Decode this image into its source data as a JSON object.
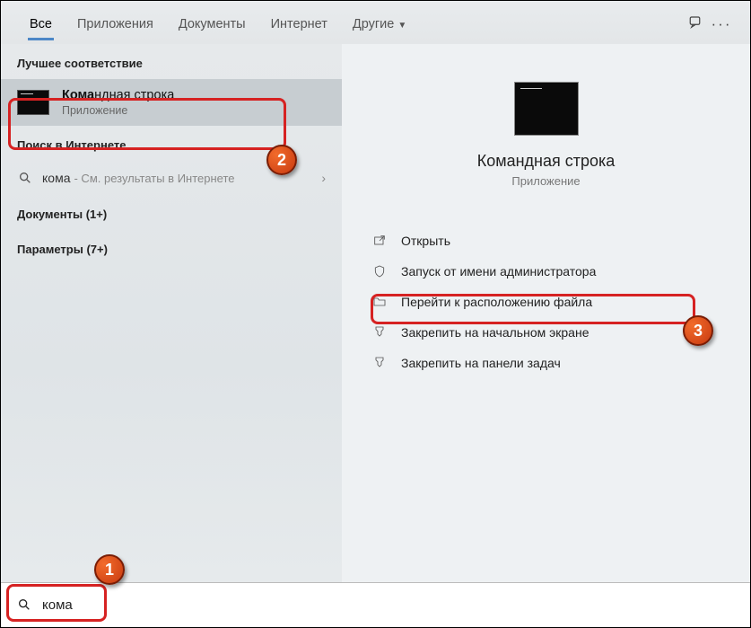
{
  "tabs": {
    "all": "Все",
    "apps": "Приложения",
    "docs": "Документы",
    "web": "Интернет",
    "more": "Другие"
  },
  "left": {
    "best_header": "Лучшее соответствие",
    "best_title_pre": "Кома",
    "best_title_post": "ндная строка",
    "best_sub": "Приложение",
    "web_header": "Поиск в Интернете",
    "web_query": "кома",
    "web_hint": " - См. результаты в Интернете",
    "docs_header": "Документы (1+)",
    "params_header": "Параметры (7+)"
  },
  "preview": {
    "title": "Командная строка",
    "sub": "Приложение"
  },
  "actions": {
    "open": "Открыть",
    "admin": "Запуск от имени администратора",
    "location": "Перейти к расположению файла",
    "pin_start": "Закрепить на начальном экране",
    "pin_task": "Закрепить на панели задач"
  },
  "search": {
    "value": "кома"
  },
  "badges": {
    "b1": "1",
    "b2": "2",
    "b3": "3"
  }
}
